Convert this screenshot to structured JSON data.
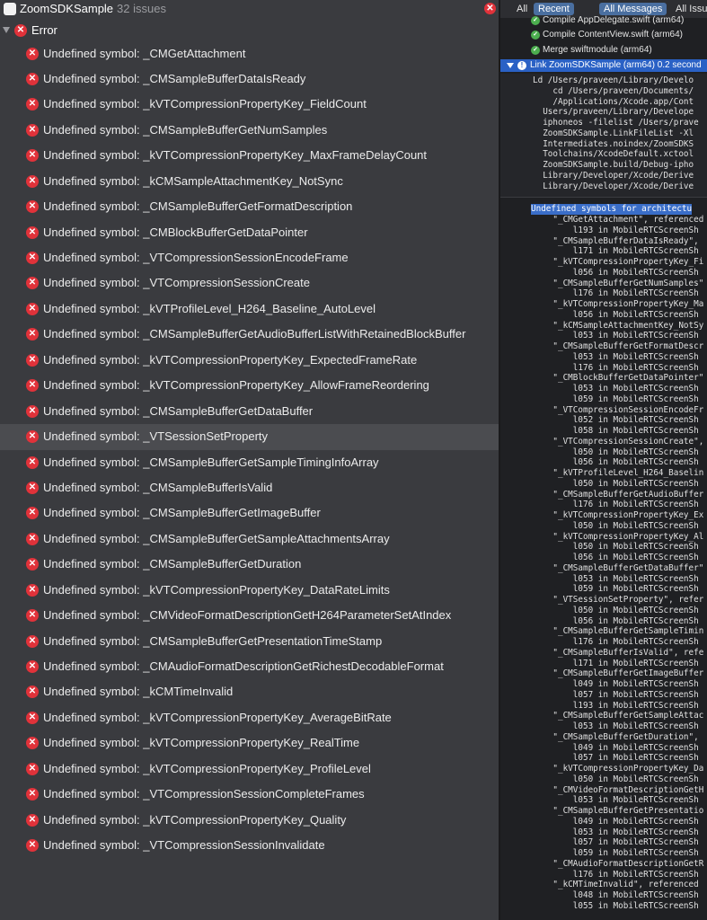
{
  "left_panel": {
    "project_title": "ZoomSDKSample",
    "issue_count": "32 issues",
    "group_label": "Error",
    "issues": [
      "Undefined symbol: _CMGetAttachment",
      "Undefined symbol: _CMSampleBufferDataIsReady",
      "Undefined symbol: _kVTCompressionPropertyKey_FieldCount",
      "Undefined symbol: _CMSampleBufferGetNumSamples",
      "Undefined symbol: _kVTCompressionPropertyKey_MaxFrameDelayCount",
      "Undefined symbol: _kCMSampleAttachmentKey_NotSync",
      "Undefined symbol: _CMSampleBufferGetFormatDescription",
      "Undefined symbol: _CMBlockBufferGetDataPointer",
      "Undefined symbol: _VTCompressionSessionEncodeFrame",
      "Undefined symbol: _VTCompressionSessionCreate",
      "Undefined symbol: _kVTProfileLevel_H264_Baseline_AutoLevel",
      "Undefined symbol: _CMSampleBufferGetAudioBufferListWithRetainedBlockBuffer",
      "Undefined symbol: _kVTCompressionPropertyKey_ExpectedFrameRate",
      "Undefined symbol: _kVTCompressionPropertyKey_AllowFrameReordering",
      "Undefined symbol: _CMSampleBufferGetDataBuffer",
      "Undefined symbol: _VTSessionSetProperty",
      "Undefined symbol: _CMSampleBufferGetSampleTimingInfoArray",
      "Undefined symbol: _CMSampleBufferIsValid",
      "Undefined symbol: _CMSampleBufferGetImageBuffer",
      "Undefined symbol: _CMSampleBufferGetSampleAttachmentsArray",
      "Undefined symbol: _CMSampleBufferGetDuration",
      "Undefined symbol: _kVTCompressionPropertyKey_DataRateLimits",
      "Undefined symbol: _CMVideoFormatDescriptionGetH264ParameterSetAtIndex",
      "Undefined symbol: _CMSampleBufferGetPresentationTimeStamp",
      "Undefined symbol: _CMAudioFormatDescriptionGetRichestDecodableFormat",
      "Undefined symbol: _kCMTimeInvalid",
      "Undefined symbol: _kVTCompressionPropertyKey_AverageBitRate",
      "Undefined symbol: _kVTCompressionPropertyKey_RealTime",
      "Undefined symbol: _kVTCompressionPropertyKey_ProfileLevel",
      "Undefined symbol: _VTCompressionSessionCompleteFrames",
      "Undefined symbol: _kVTCompressionPropertyKey_Quality",
      "Undefined symbol: _VTCompressionSessionInvalidate"
    ],
    "selected_index": 15
  },
  "right_panel": {
    "filters": {
      "all": "All",
      "recent": "Recent",
      "all_messages": "All Messages",
      "all_issues": "All Issue"
    },
    "steps": [
      "Compile AppDelegate.swift (arm64)",
      "Compile ContentView.swift (arm64)",
      "Merge swiftmodule (arm64)"
    ],
    "link_step": "Link ZoomSDKSample (arm64) 0.2 second",
    "ld_command": "Ld /Users/praveen/Library/Develo\n    cd /Users/praveen/Documents/\n    /Applications/Xcode.app/Cont\n  Users/praveen/Library/Develope\n  iphoneos -filelist /Users/prave\n  ZoomSDKSample.LinkFileList -Xl\n  Intermediates.noindex/ZoomSDKS\n  Toolchains/XcodeDefault.xctool\n  ZoomSDKSample.build/Debug-ipho\n  Library/Developer/Xcode/Derive\n  Library/Developer/Xcode/Derive",
    "log_heading": "Undefined symbols for architectu",
    "log_body": "    \"_CMGetAttachment\", referenced\n        l193 in MobileRTCScreenSh\n    \"_CMSampleBufferDataIsReady\",\n        l171 in MobileRTCScreenSh\n    \"_kVTCompressionPropertyKey_Fi\n        l056 in MobileRTCScreenSh\n    \"_CMSampleBufferGetNumSamples\"\n        l176 in MobileRTCScreenSh\n    \"_kVTCompressionPropertyKey_Ma\n        l056 in MobileRTCScreenSh\n    \"_kCMSampleAttachmentKey_NotSy\n        l053 in MobileRTCScreenSh\n    \"_CMSampleBufferGetFormatDescr\n        l053 in MobileRTCScreenSh\n        l176 in MobileRTCScreenSh\n    \"_CMBlockBufferGetDataPointer\"\n        l053 in MobileRTCScreenSh\n        l059 in MobileRTCScreenSh\n    \"_VTCompressionSessionEncodeFr\n        l052 in MobileRTCScreenSh\n        l058 in MobileRTCScreenSh\n    \"_VTCompressionSessionCreate\",\n        l050 in MobileRTCScreenSh\n        l056 in MobileRTCScreenSh\n    \"_kVTProfileLevel_H264_Baselin\n        l050 in MobileRTCScreenSh\n    \"_CMSampleBufferGetAudioBuffer\n        l176 in MobileRTCScreenSh\n    \"_kVTCompressionPropertyKey_Ex\n        l050 in MobileRTCScreenSh\n    \"_kVTCompressionPropertyKey_Al\n        l050 in MobileRTCScreenSh\n        l056 in MobileRTCScreenSh\n    \"_CMSampleBufferGetDataBuffer\"\n        l053 in MobileRTCScreenSh\n        l059 in MobileRTCScreenSh\n    \"_VTSessionSetProperty\", refer\n        l050 in MobileRTCScreenSh\n        l056 in MobileRTCScreenSh\n    \"_CMSampleBufferGetSampleTimin\n        l176 in MobileRTCScreenSh\n    \"_CMSampleBufferIsValid\", refe\n        l171 in MobileRTCScreenSh\n    \"_CMSampleBufferGetImageBuffer\n        l049 in MobileRTCScreenSh\n        l057 in MobileRTCScreenSh\n        l193 in MobileRTCScreenSh\n    \"_CMSampleBufferGetSampleAttac\n        l053 in MobileRTCScreenSh\n    \"_CMSampleBufferGetDuration\",\n        l049 in MobileRTCScreenSh\n        l057 in MobileRTCScreenSh\n    \"_kVTCompressionPropertyKey_Da\n        l050 in MobileRTCScreenSh\n    \"_CMVideoFormatDescriptionGetH\n        l053 in MobileRTCScreenSh\n    \"_CMSampleBufferGetPresentatio\n        l049 in MobileRTCScreenSh\n        l053 in MobileRTCScreenSh\n        l057 in MobileRTCScreenSh\n        l059 in MobileRTCScreenSh\n    \"_CMAudioFormatDescriptionGetR\n        l176 in MobileRTCScreenSh\n    \"_kCMTimeInvalid\", referenced\n        l048 in MobileRTCScreenSh\n        l055 in MobileRTCScreenSh"
  },
  "colors": {
    "error_red": "#e0323a",
    "selection_blue": "#2a61c5",
    "success_green": "#4cae4f"
  }
}
